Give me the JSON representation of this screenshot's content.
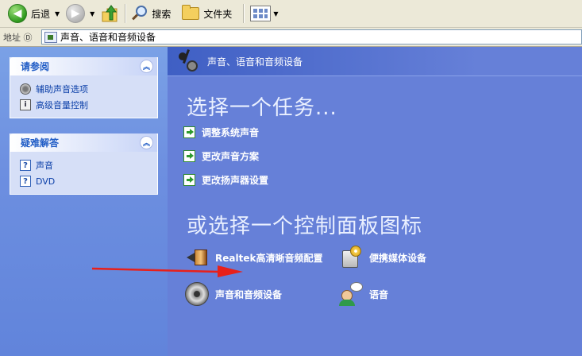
{
  "toolbar": {
    "back_label": "后退",
    "search_label": "搜索",
    "folders_label": "文件夹"
  },
  "address": {
    "label": "地址",
    "shortcut": "Ⓓ",
    "path": "声音、语音和音频设备"
  },
  "sidebar": {
    "see_also": {
      "title": "请参阅",
      "items": [
        {
          "label": "辅助声音选项",
          "icon": "speaker-icon"
        },
        {
          "label": "高级音量控制",
          "icon": "info-icon"
        }
      ]
    },
    "troubleshooters": {
      "title": "疑难解答",
      "items": [
        {
          "label": "声音",
          "icon": "help-icon"
        },
        {
          "label": "DVD",
          "icon": "help-icon"
        }
      ]
    }
  },
  "main": {
    "header_title": "声音、语音和音频设备",
    "task_heading": "选择一个任务...",
    "tasks": [
      {
        "label": "调整系统声音"
      },
      {
        "label": "更改声音方案"
      },
      {
        "label": "更改扬声器设置"
      }
    ],
    "cp_heading": "或选择一个控制面板图标",
    "cp_items": [
      {
        "label": "Realtek高清晰音频配置",
        "icon": "realtek-speaker-icon"
      },
      {
        "label": "便携媒体设备",
        "icon": "portable-media-icon"
      },
      {
        "label": "声音和音频设备",
        "icon": "speaker-icon"
      },
      {
        "label": "语音",
        "icon": "speech-icon"
      }
    ]
  },
  "colors": {
    "sidebar_blue": "#6d8fe0",
    "main_blue": "#6680d8",
    "link_blue": "#0b3fa8",
    "annotation_red": "#e8201a"
  }
}
